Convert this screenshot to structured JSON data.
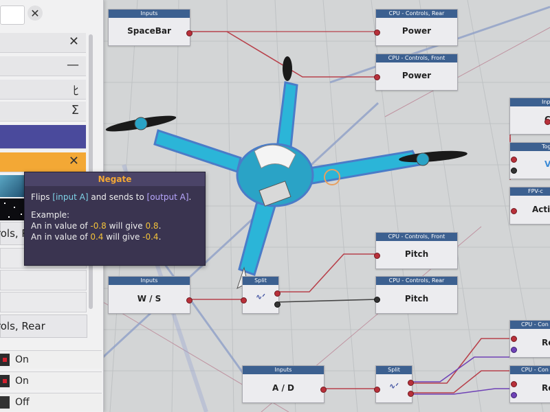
{
  "sidebar": {
    "close_glyph": "✕",
    "rows": [
      {
        "glyph": "✕"
      },
      {
        "glyph": "—"
      },
      {
        "glyph": "ﾋ"
      },
      {
        "glyph": "Σ"
      },
      {
        "glyph": ""
      },
      {
        "glyph": "✕"
      }
    ],
    "selected_rows": [
      {
        "label": "trols, Rear"
      },
      {
        "label": "trols, Rear"
      }
    ],
    "toggles": [
      {
        "label": "On",
        "state": "on"
      },
      {
        "label": "On",
        "state": "on"
      },
      {
        "label": "Off",
        "state": "off"
      }
    ]
  },
  "tooltip": {
    "title": "Negate",
    "line1_a": "Flips ",
    "input_a": "[input A]",
    "line1_b": " and sends to ",
    "output_a": "[output A]",
    "line1_c": ".",
    "example": "Example:",
    "l2_a": "An in value of ",
    "l2_v1": "-0.8",
    "l2_b": " will give ",
    "l2_v2": "0.8",
    "l2_c": ".",
    "l3_a": "An in value of ",
    "l3_v1": "0.4",
    "l3_b": " will give ",
    "l3_v2": "-0.4",
    "l3_c": "."
  },
  "nodes": [
    {
      "header": "Inputs",
      "body": "SpaceBar"
    },
    {
      "header": "CPU - Controls, Rear",
      "body": "Power"
    },
    {
      "header": "CPU - Controls, Front",
      "body": "Power"
    },
    {
      "header": "Inputs",
      "body": "W / S"
    },
    {
      "header": "Split",
      "body": ""
    },
    {
      "header": "CPU - Controls, Front",
      "body": "Pitch"
    },
    {
      "header": "CPU - Controls, Rear",
      "body": "Pitch"
    },
    {
      "header": "Inputs",
      "body": "A / D"
    },
    {
      "header": "Split",
      "body": ""
    },
    {
      "header": "CPU - Con",
      "body": "Re"
    },
    {
      "header": "CPU - Con",
      "body": "Re"
    },
    {
      "header": "Inp",
      "body": "C"
    },
    {
      "header": "Tog",
      "body": "V"
    },
    {
      "header": "FPV-c",
      "body": "Acti"
    }
  ],
  "colors": {
    "accent_orange": "#f3a835",
    "node_header": "#3c6090",
    "wire": "#b8414b",
    "drone_cyan": "#2bb5d8"
  }
}
